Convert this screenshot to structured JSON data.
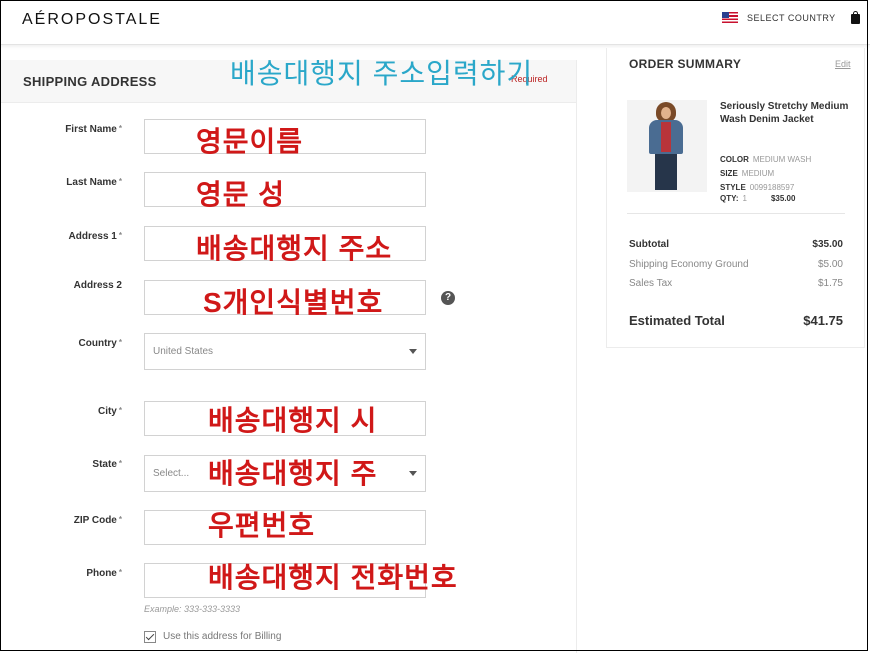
{
  "header": {
    "logo": "AÉROPOSTALE",
    "country_label": "SELECT COUNTRY"
  },
  "shipping": {
    "title": "SHIPPING ADDRESS",
    "required": "Required",
    "annotation_title": "배송대행지 주소입력하기",
    "fields": {
      "first_name": {
        "label": "First Name",
        "star": "*",
        "annotation": "영문이름"
      },
      "last_name": {
        "label": "Last Name",
        "star": "*",
        "annotation": "영문 성"
      },
      "address1": {
        "label": "Address 1",
        "star": "*",
        "annotation": "배송대행지 주소"
      },
      "address2": {
        "label": "Address 2",
        "annotation": "S개인식별번호"
      },
      "country": {
        "label": "Country",
        "star": "*",
        "value": "United States"
      },
      "city": {
        "label": "City",
        "star": "*",
        "annotation": "배송대행지 시"
      },
      "state": {
        "label": "State",
        "star": "*",
        "placeholder": "Select...",
        "annotation": "배송대행지 주"
      },
      "zip": {
        "label": "ZIP Code",
        "star": "*",
        "annotation": "우편번호"
      },
      "phone": {
        "label": "Phone",
        "star": "*",
        "annotation": "배송대행지 전화번호",
        "hint": "Example: 333-333-3333"
      }
    },
    "help_icon": "?",
    "billing_checkbox_label": "Use this address for Billing",
    "billing_checked": true
  },
  "summary": {
    "title": "ORDER SUMMARY",
    "edit": "Edit",
    "product": {
      "name": "Seriously Stretchy Medium Wash Denim Jacket",
      "color_label": "COLOR",
      "color_value": "MEDIUM WASH",
      "size_label": "SIZE",
      "size_value": "MEDIUM",
      "style_label": "STYLE",
      "style_value": "0099188597",
      "qty_label": "QTY:",
      "qty_value": "1",
      "price": "$35.00"
    },
    "subtotal_label": "Subtotal",
    "subtotal_value": "$35.00",
    "shipping_label": "Shipping Economy Ground",
    "shipping_value": "$5.00",
    "tax_label": "Sales Tax",
    "tax_value": "$1.75",
    "total_label": "Estimated Total",
    "total_value": "$41.75"
  }
}
